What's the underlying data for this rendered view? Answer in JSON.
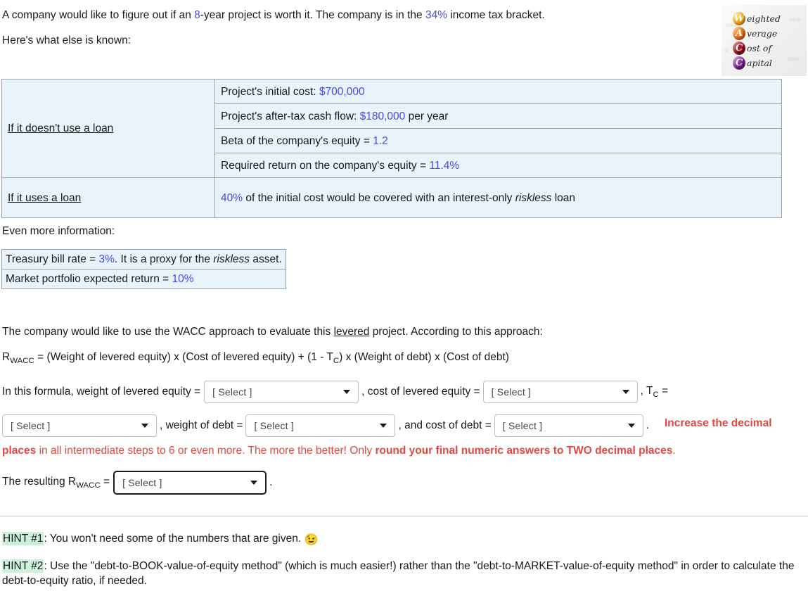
{
  "intro": {
    "line1_a": "A company would like to figure out if an ",
    "line1_years": "8",
    "line1_b": "-year project is worth it. The company is in the ",
    "line1_tax": "34%",
    "line1_c": " income tax bracket.",
    "line2": "Here's what else is known:"
  },
  "logo": {
    "letters": [
      "W",
      "A",
      "C",
      "C"
    ],
    "words": [
      "eighted",
      "verage",
      "ost of",
      "apital"
    ],
    "colors": [
      "#f5a515",
      "#ef6c12",
      "#8e1220",
      "#7a1d94"
    ],
    "alt": "Weighted Average Cost of Capital"
  },
  "main_table": {
    "row_labels": {
      "no_loan": "If it doesn't use a loan",
      "loan": "If it uses a loan"
    },
    "no_loan_items": [
      {
        "text_a": "Project's initial cost: ",
        "value": "$700,000",
        "text_b": ""
      },
      {
        "text_a": "Project's after-tax cash flow: ",
        "value": "$180,000",
        "text_b": " per year"
      },
      {
        "text_a": "Beta of the company's equity = ",
        "value": "1.2",
        "text_b": ""
      },
      {
        "text_a": "Required return on the company's equity = ",
        "value": "11.4%",
        "text_b": ""
      }
    ],
    "loan_item": {
      "value": "40%",
      "text_a": " of the initial cost would be covered with an interest-only ",
      "italic": "riskless",
      "text_b": " loan"
    }
  },
  "even_more": {
    "heading": "Even more information:",
    "rows": [
      {
        "text_a": "Treasury bill rate = ",
        "value": "3%",
        "text_b": ". It is a proxy for the ",
        "italic": "riskless",
        "text_c": " asset."
      },
      {
        "text_a": "Market portfolio expected return = ",
        "value": "10%",
        "text_b": "",
        "italic": "",
        "text_c": ""
      }
    ]
  },
  "approach": {
    "text_a": "The company would like to use the WACC approach to evaluate this ",
    "underlined": "levered",
    "text_b": " project. According to this approach:",
    "formula_prefix": "R",
    "formula_sub": "WACC",
    "formula_body_a": " = (Weight of levered equity) x (Cost of levered equity) + (1 - T",
    "formula_sub2": "C",
    "formula_body_b": ") x (Weight of debt) x (Cost of debt)"
  },
  "selects": {
    "placeholder": "[ Select ]",
    "label_1": "In this formula, weight of levered equity =",
    "label_2": ", cost of levered equity =",
    "label_3": ", T",
    "label_3_sub": "C",
    "label_3_eq": " =",
    "label_4": ", weight of debt =",
    "label_5": ",  and cost of debt =",
    "label_6": ".",
    "result_label_a": "The resulting R",
    "result_label_sub": "WACC",
    "result_label_b": " =",
    "result_period": "."
  },
  "red_note": {
    "part1": "Increase the decimal",
    "part2_bold_a": "places",
    "part2_plain_a": " in all intermediate steps to 6 or even more. The more the better! Only ",
    "part2_bold_b": "round your final numeric answers to TWO decimal places",
    "part2_plain_b": "."
  },
  "hints": {
    "hint1_badge": "HINT #1",
    "hint1_text": ": You won't need some of the numbers that are given. ",
    "hint1_emoji": "😉",
    "hint2_badge": "HINT #2",
    "hint2_text": ": Use the \"debt-to-BOOK-value-of-equity method\" (which is much easier!) rather than the \"debt-to-MARKET-value-of-equity method\" in order to calculate the debt-to-equity ratio, if needed."
  },
  "colors": {
    "value_blue": "#4a4ae0",
    "table_bg": "#e8f3fb",
    "warn_red": "#e0493f",
    "hint_highlight": "#cdf0da"
  }
}
